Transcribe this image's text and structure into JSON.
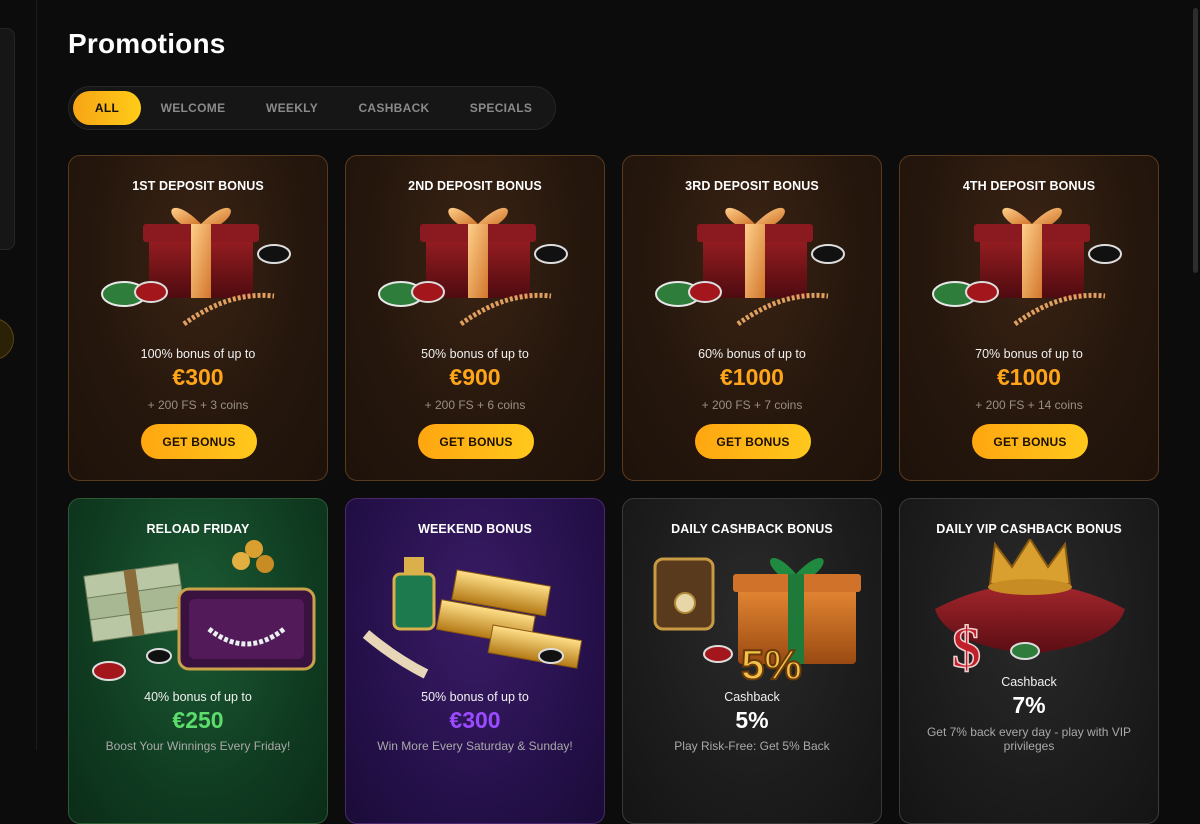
{
  "page": {
    "title": "Promotions"
  },
  "tabs": [
    {
      "label": "ALL",
      "active": true
    },
    {
      "label": "WELCOME",
      "active": false
    },
    {
      "label": "WEEKLY",
      "active": false
    },
    {
      "label": "CASHBACK",
      "active": false
    },
    {
      "label": "SPECIALS",
      "active": false
    }
  ],
  "colors": {
    "accent": "#ffb21a",
    "amount_orange": "#ffa51a",
    "amount_green": "#5cdc6a",
    "amount_purple": "#9b4bff",
    "background": "#0c0c0d"
  },
  "promotions": [
    {
      "title": "1ST DEPOSIT BONUS",
      "subtitle": "100% bonus of up to",
      "amount": "€300",
      "extra": "+ 200 FS + 3 coins",
      "button": "GET BONUS",
      "theme": "brown",
      "art": "gift-box-casino-chips"
    },
    {
      "title": "2ND DEPOSIT BONUS",
      "subtitle": "50% bonus of up to",
      "amount": "€900",
      "extra": "+ 200 FS + 6 coins",
      "button": "GET BONUS",
      "theme": "brown",
      "art": "gift-box-casino-chips"
    },
    {
      "title": "3RD DEPOSIT BONUS",
      "subtitle": "60% bonus of up to",
      "amount": "€1000",
      "extra": "+ 200 FS + 7 coins",
      "button": "GET BONUS",
      "theme": "brown",
      "art": "gift-box-casino-chips"
    },
    {
      "title": "4TH DEPOSIT BONUS",
      "subtitle": "70% bonus of up to",
      "amount": "€1000",
      "extra": "+ 200 FS + 14 coins",
      "button": "GET BONUS",
      "theme": "brown",
      "art": "gift-box-casino-chips"
    },
    {
      "title": "RELOAD FRIDAY",
      "subtitle": "40% bonus of up to",
      "amount": "€250",
      "description": "Boost Your Winnings Every Friday!",
      "theme": "green",
      "art": "cash-stacks-jewelry-box"
    },
    {
      "title": "WEEKEND BONUS",
      "subtitle": "50% bonus of up to",
      "amount": "€300",
      "description": "Win More Every Saturday & Sunday!",
      "theme": "purple",
      "art": "gold-bars-perfume"
    },
    {
      "title": "DAILY CASHBACK BONUS",
      "subtitle": "Cashback",
      "amount": "5%",
      "description": "Play Risk-Free: Get 5% Back",
      "theme": "dark",
      "art": "gift-box-watch-5-percent"
    },
    {
      "title": "DAILY VIP CASHBACK BONUS",
      "subtitle": "Cashback",
      "amount": "7%",
      "description": "Get 7% back every day - play with VIP privileges",
      "theme": "dark",
      "art": "crown-on-pillow-dollar"
    }
  ]
}
